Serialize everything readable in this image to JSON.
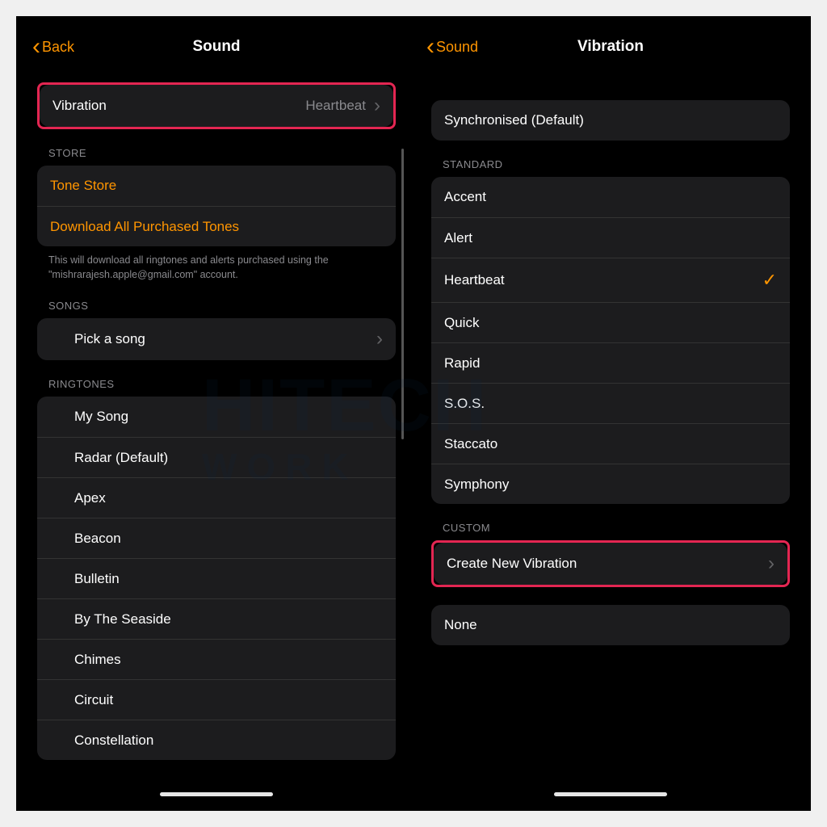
{
  "left": {
    "back": "Back",
    "title": "Sound",
    "vibration_row": {
      "label": "Vibration",
      "value": "Heartbeat"
    },
    "store_header": "STORE",
    "store": {
      "tone_store": "Tone Store",
      "download_all": "Download All Purchased Tones",
      "footer": "This will download all ringtones and alerts purchased using the \"mishrarajesh.apple@gmail.com\" account."
    },
    "songs_header": "SONGS",
    "songs": {
      "pick": "Pick a song"
    },
    "ringtones_header": "RINGTONES",
    "ringtones": [
      "My Song",
      "Radar (Default)",
      "Apex",
      "Beacon",
      "Bulletin",
      "By The Seaside",
      "Chimes",
      "Circuit",
      "Constellation"
    ]
  },
  "right": {
    "back": "Sound",
    "title": "Vibration",
    "sync": "Synchronised (Default)",
    "standard_header": "STANDARD",
    "standard": [
      {
        "label": "Accent",
        "selected": false
      },
      {
        "label": "Alert",
        "selected": false
      },
      {
        "label": "Heartbeat",
        "selected": true
      },
      {
        "label": "Quick",
        "selected": false
      },
      {
        "label": "Rapid",
        "selected": false
      },
      {
        "label": "S.O.S.",
        "selected": false
      },
      {
        "label": "Staccato",
        "selected": false
      },
      {
        "label": "Symphony",
        "selected": false
      }
    ],
    "custom_header": "CUSTOM",
    "create_new": "Create New Vibration",
    "none": "None"
  },
  "watermark": {
    "line1": "HITECH",
    "line2": "WORK"
  }
}
